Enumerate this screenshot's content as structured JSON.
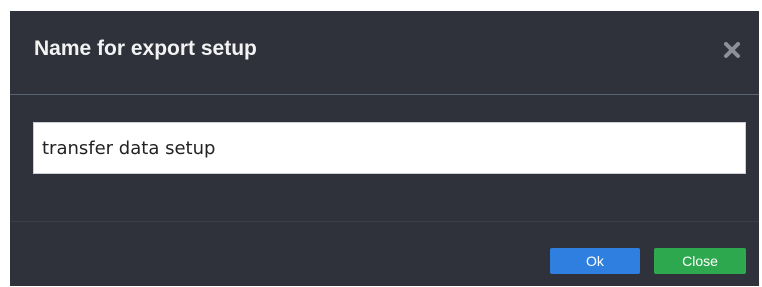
{
  "dialog": {
    "title": "Name for export setup",
    "close_icon": "close-x-icon",
    "input": {
      "value": "transfer data setup",
      "placeholder": ""
    },
    "buttons": {
      "ok_label": "Ok",
      "close_label": "Close"
    }
  },
  "colors": {
    "dialog_background": "#2f323a",
    "ok_button": "#2f7fe0",
    "close_button": "#2ea84f"
  }
}
